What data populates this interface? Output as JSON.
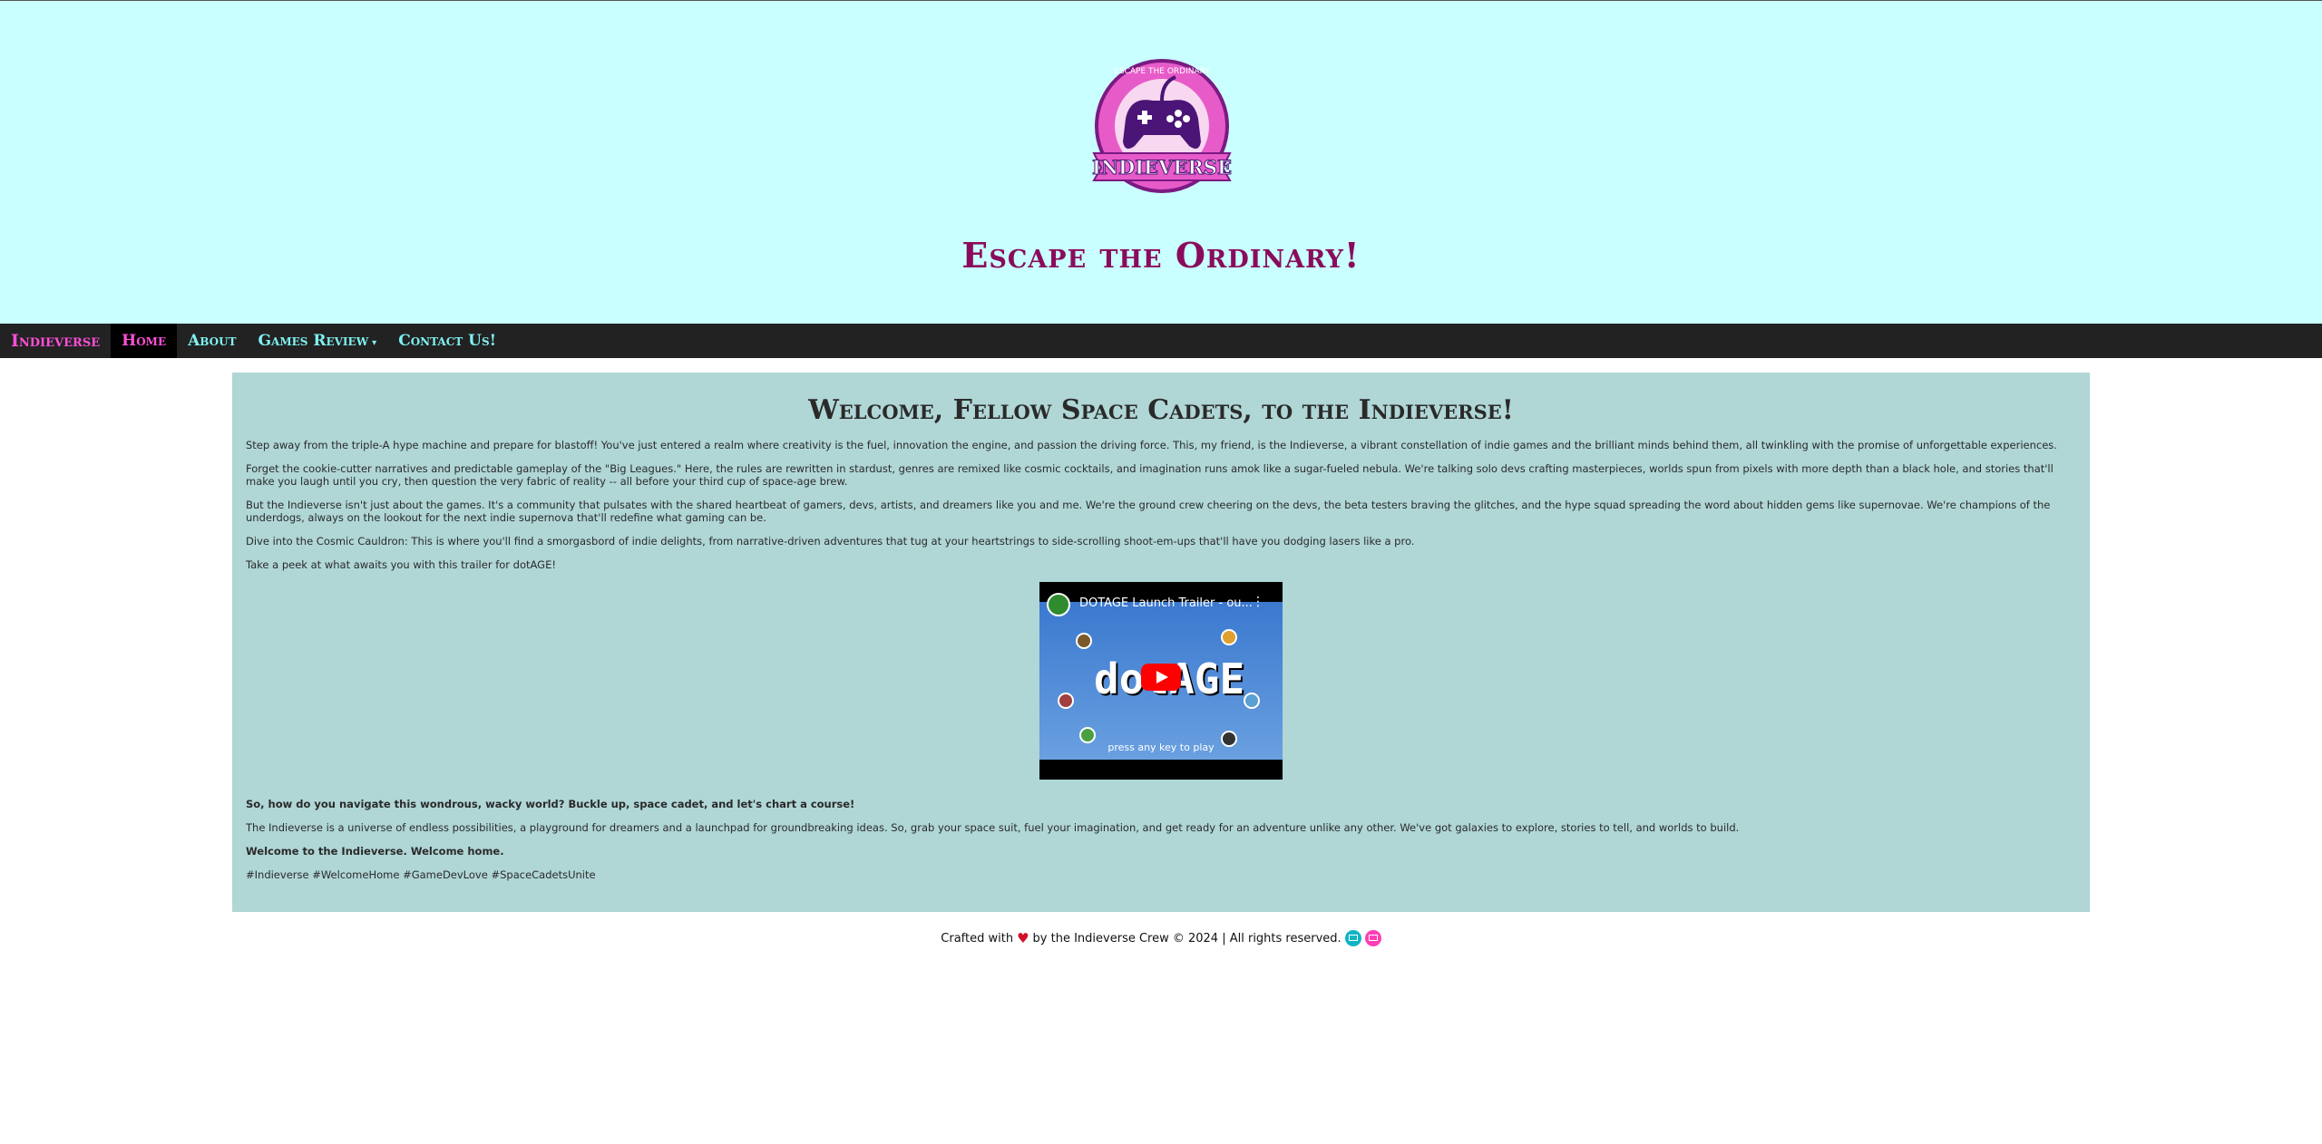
{
  "header": {
    "logo_top_text": "ESCAPE THE ORDINARY",
    "logo_banner_text": "INDIEVERSE",
    "tagline": "Escape the Ordinary!"
  },
  "nav": {
    "brand": "Indieverse",
    "items": [
      {
        "label": "Home",
        "active": true
      },
      {
        "label": "About"
      },
      {
        "label": "Games Review"
      },
      {
        "label": "Contact Us!"
      }
    ]
  },
  "main": {
    "title": "Welcome, Fellow Space Cadets, to the Indieverse!",
    "paragraphs": [
      "Step away from the triple-A hype machine and prepare for blastoff! You've just entered a realm where creativity is the fuel, innovation the engine, and passion the driving force. This, my friend, is the Indieverse, a vibrant constellation of indie games and the brilliant minds behind them, all twinkling with the promise of unforgettable experiences.",
      "Forget the cookie-cutter narratives and predictable gameplay of the \"Big Leagues.\" Here, the rules are rewritten in stardust, genres are remixed like cosmic cocktails, and imagination runs amok like a sugar-fueled nebula. We're talking solo devs crafting masterpieces, worlds spun from pixels with more depth than a black hole, and stories that'll make you laugh until you cry, then question the very fabric of reality -- all before your third cup of space-age brew.",
      "But the Indieverse isn't just about the games. It's a community that pulsates with the shared heartbeat of gamers, devs, artists, and dreamers like you and me. We're the ground crew cheering on the devs, the beta testers braving the glitches, and the hype squad spreading the word about hidden gems like supernovae. We're champions of the underdogs, always on the lookout for the next indie supernova that'll redefine what gaming can be.",
      "Dive into the Cosmic Cauldron: This is where you'll find a smorgasbord of indie delights, from narrative-driven adventures that tug at your heartstrings to side-scrolling shoot-em-ups that'll have you dodging lasers like a pro.",
      "Take a peek at what awaits you with this trailer for dotAGE!"
    ],
    "video": {
      "title": "DOTAGE Launch Trailer - ou...",
      "game_logo": "dotAGE",
      "press_text": "press any key to play"
    },
    "after": {
      "question": "So, how do you navigate this wondrous, wacky world? Buckle up, space cadet, and let's chart a course!",
      "summary": "The Indieverse is a universe of endless possibilities, a playground for dreamers and a launchpad for groundbreaking ideas. So, grab your space suit, fuel your imagination, and get ready for an adventure unlike any other. We've got galaxies to explore, stories to tell, and worlds to build.",
      "welcome_home": "Welcome to the Indieverse. Welcome home.",
      "hashtags": "#Indieverse #WelcomeHome #GameDevLove #SpaceCadetsUnite"
    }
  },
  "footer": {
    "crafted": "Crafted with",
    "rest": "by the Indieverse Crew © 2024 | All rights reserved."
  },
  "colors": {
    "header_bg": "#c9ffff",
    "nav_bg": "#222222",
    "brand_pink": "#ff4fd8",
    "nav_cyan": "#7ff0f0",
    "content_bg": "#b0d6d6",
    "tagline": "#8a0b5b"
  }
}
